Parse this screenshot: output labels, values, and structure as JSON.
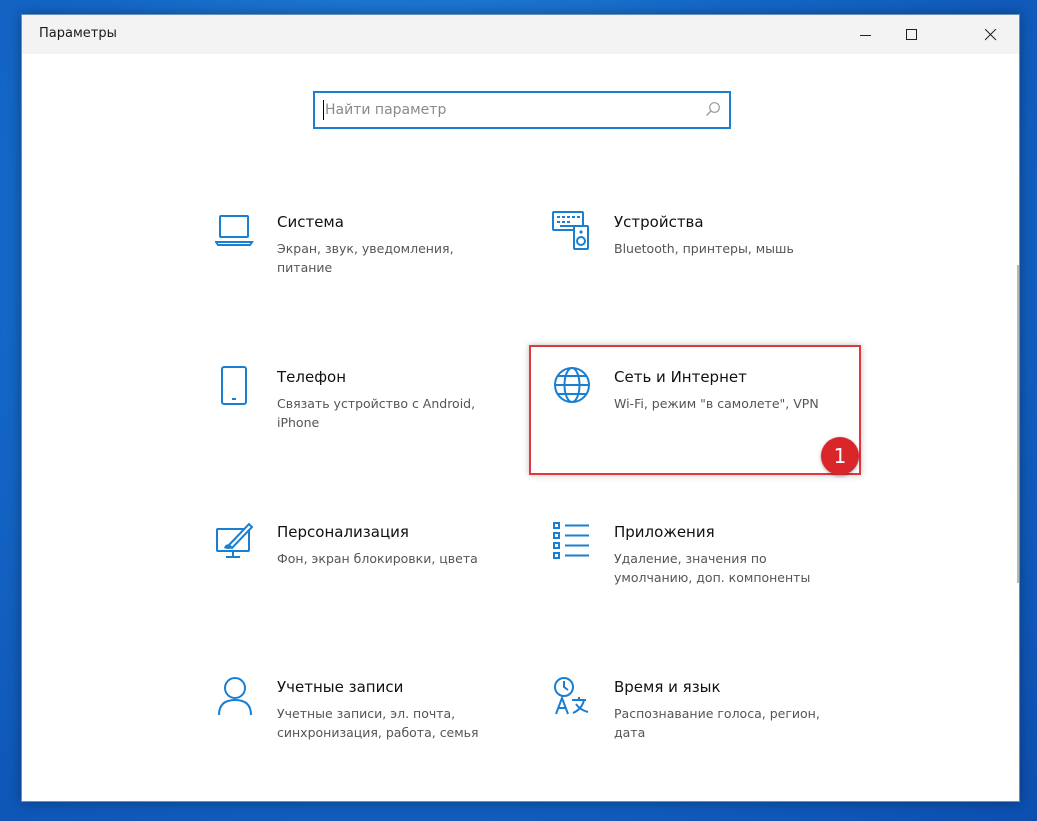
{
  "window": {
    "title": "Параметры",
    "accent_color": "#1a7fd1",
    "highlight_color": "#e0383e"
  },
  "search": {
    "placeholder": "Найти параметр",
    "value": ""
  },
  "tiles": [
    {
      "name": "Система",
      "desc": "Экран, звук, уведомления, питание",
      "icon": "laptop-icon"
    },
    {
      "name": "Устройства",
      "desc": "Bluetooth, принтеры, мышь",
      "icon": "devices-icon"
    },
    {
      "name": "Телефон",
      "desc": "Связать устройство с Android, iPhone",
      "icon": "phone-icon"
    },
    {
      "name": "Сеть и Интернет",
      "desc": "Wi-Fi, режим \"в самолете\", VPN",
      "icon": "globe-icon"
    },
    {
      "name": "Персонализация",
      "desc": "Фон, экран блокировки, цвета",
      "icon": "personalization-icon"
    },
    {
      "name": "Приложения",
      "desc": "Удаление, значения по умолчанию, доп. компоненты",
      "icon": "apps-list-icon"
    },
    {
      "name": "Учетные записи",
      "desc": "Учетные записи, эл. почта, синхронизация, работа, семья",
      "icon": "person-icon"
    },
    {
      "name": "Время и язык",
      "desc": "Распознавание голоса, регион, дата",
      "icon": "time-language-icon"
    }
  ],
  "annotation": {
    "badge_number": "1"
  }
}
